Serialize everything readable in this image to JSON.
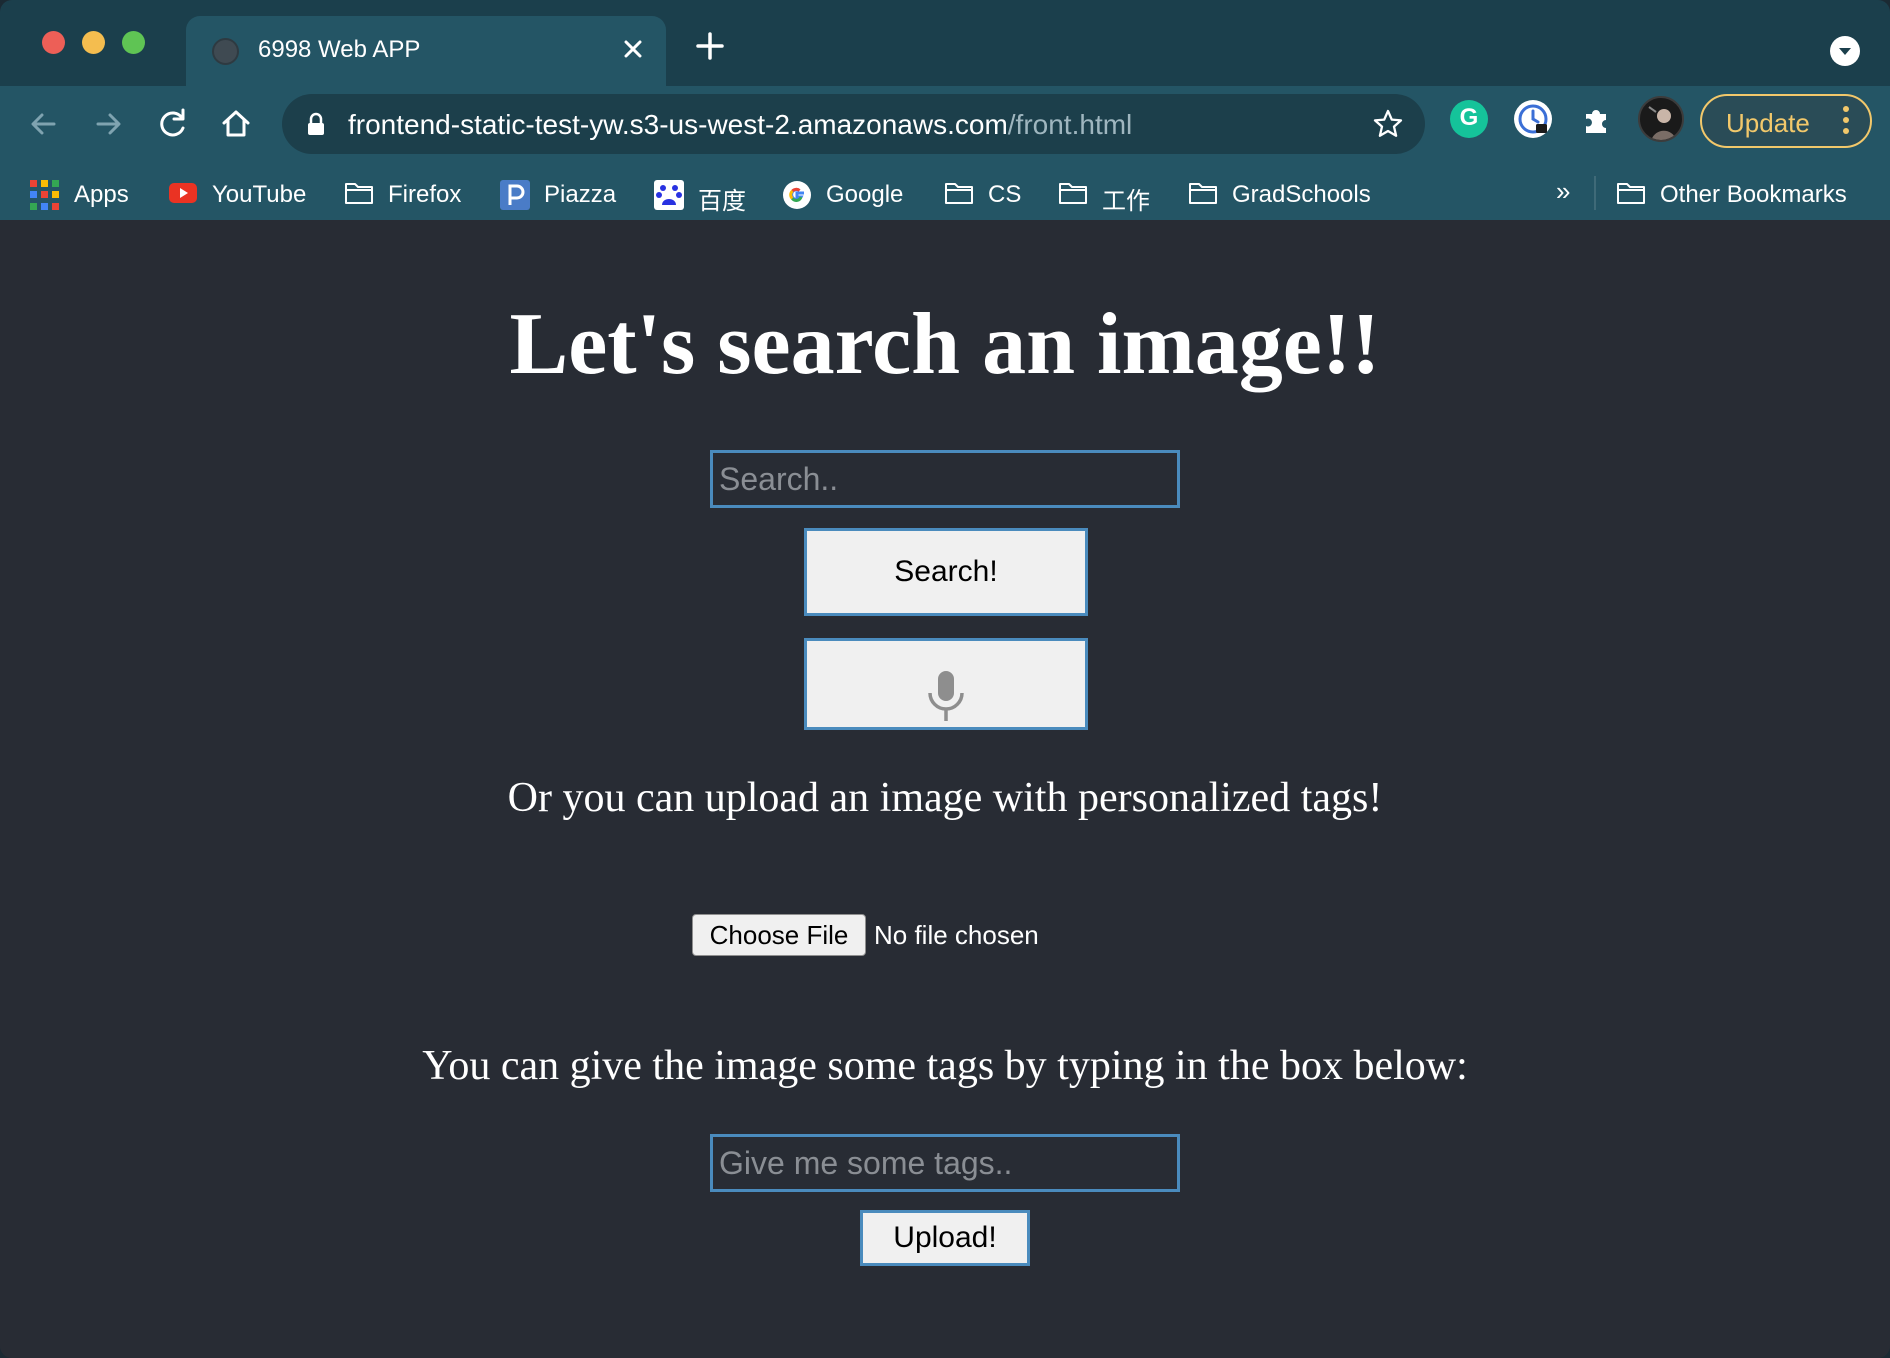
{
  "browser": {
    "tab": {
      "title": "6998 Web APP"
    },
    "url": {
      "host": "frontend-static-test-yw.s3-us-west-2.amazonaws.com",
      "path": "/front.html"
    },
    "update_label": "Update",
    "bookmarks": [
      {
        "label": "Apps",
        "icon": "apps-grid-icon"
      },
      {
        "label": "YouTube",
        "icon": "youtube-icon"
      },
      {
        "label": "Firefox",
        "icon": "folder-icon"
      },
      {
        "label": "Piazza",
        "icon": "piazza-icon"
      },
      {
        "label": "百度",
        "icon": "baidu-icon"
      },
      {
        "label": "Google",
        "icon": "google-icon"
      },
      {
        "label": "CS",
        "icon": "folder-icon"
      },
      {
        "label": "工作",
        "icon": "folder-icon"
      },
      {
        "label": "GradSchools",
        "icon": "folder-icon"
      }
    ],
    "bookmarks_more": "»",
    "other_bookmarks": "Other Bookmarks",
    "colors": {
      "tabstrip": "#1b3f4c",
      "toolbar": "#245565",
      "update_accent": "#f2c86b"
    }
  },
  "page": {
    "heading": "Let's search an image!!",
    "search": {
      "placeholder": "Search..",
      "value": ""
    },
    "search_button": "Search!",
    "mic_button_icon": "microphone-icon",
    "upload_prompt": "Or you can upload an image with personalized tags!",
    "file": {
      "button_label": "Choose File",
      "status": "No file chosen"
    },
    "tags_prompt": "You can give the image some tags by typing in the box below:",
    "tags": {
      "placeholder": "Give me some tags..",
      "value": ""
    },
    "upload_button": "Upload!",
    "colors": {
      "background": "#282c34",
      "input_border": "#4a8bbd",
      "button_bg": "#f0f0f0"
    }
  }
}
